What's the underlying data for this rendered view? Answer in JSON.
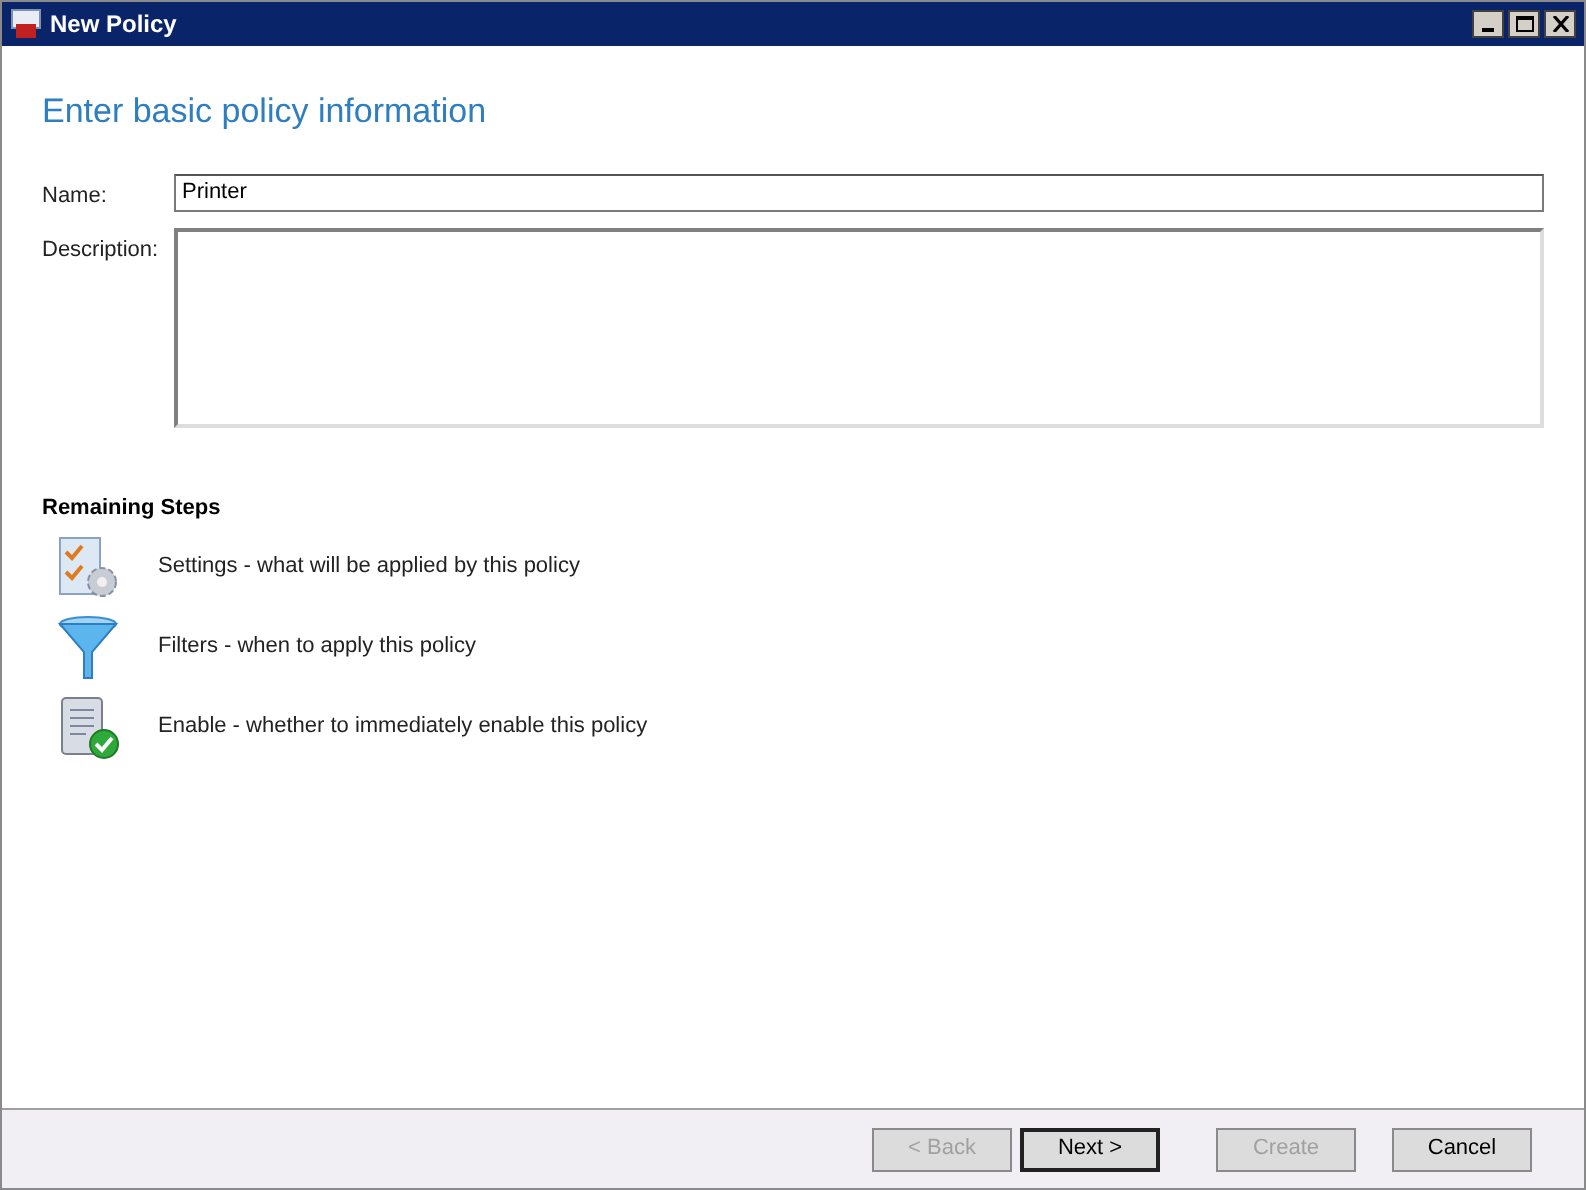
{
  "window": {
    "title": "New Policy"
  },
  "heading": "Enter basic policy information",
  "fields": [
    {
      "kind": "line",
      "label": "Name:",
      "value": "Printer"
    },
    {
      "kind": "multiline",
      "label": "Description:"
    }
  ],
  "steps_title": "Remaining Steps",
  "steps": [
    {
      "kind": "settings",
      "text": "Settings - what will be applied by this policy"
    },
    {
      "kind": "filter",
      "text": "Filters - when to apply this policy"
    },
    {
      "kind": "enable",
      "text": "Enable - whether to immediately enable this policy"
    }
  ],
  "buttons": [
    {
      "label": "< Back",
      "disabled": true,
      "default": false
    },
    {
      "label": "Next >",
      "disabled": false,
      "default": true
    },
    {
      "label": "Create",
      "disabled": true,
      "default": false
    },
    {
      "label": "Cancel",
      "disabled": false,
      "default": false
    }
  ]
}
